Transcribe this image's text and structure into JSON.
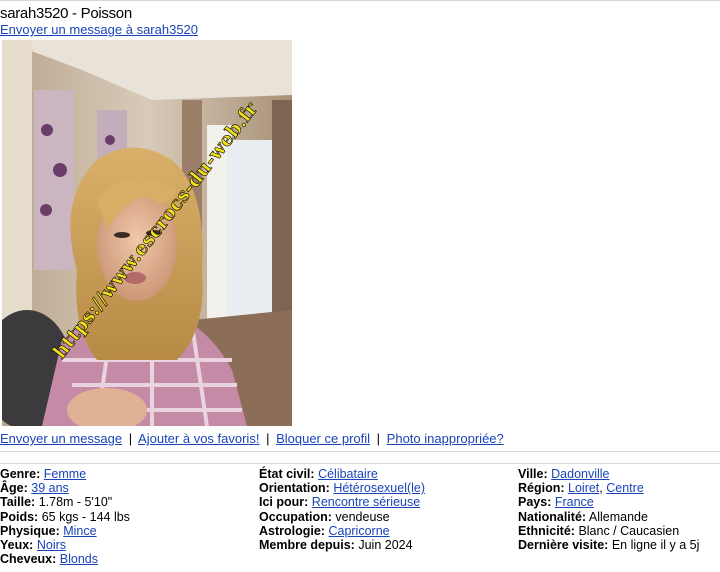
{
  "profile": {
    "title": "sarah3520 - Poisson",
    "send_message_link": "Envoyer un message à sarah3520",
    "photo": {
      "watermark": "https://www.escrocs-du-web.fr"
    }
  },
  "actions": {
    "send_message": "Envoyer un message",
    "add_favorite": "Ajouter à vos favoris!",
    "block": "Bloquer ce profil",
    "report_photo": "Photo inappropriée?",
    "separator": "|"
  },
  "details": {
    "col1": [
      {
        "label": "Genre:",
        "value": "Femme",
        "link": true
      },
      {
        "label": "Âge:",
        "value": "39 ans",
        "link": true
      },
      {
        "label": "Taille:",
        "value": "1.78m - 5'10\"",
        "link": false
      },
      {
        "label": "Poids:",
        "value": "65 kgs - 144 lbs",
        "link": false
      },
      {
        "label": "Physique:",
        "value": "Mince",
        "link": true
      },
      {
        "label": "Yeux:",
        "value": "Noirs",
        "link": true
      },
      {
        "label": "Cheveux:",
        "value": "Blonds",
        "link": true
      }
    ],
    "col2": [
      {
        "label": "État civil:",
        "value": "Célibataire",
        "link": true
      },
      {
        "label": "Orientation:",
        "value": "Hétérosexuel(le)",
        "link": true
      },
      {
        "label": "Ici pour:",
        "value": "Rencontre sérieuse",
        "link": true
      },
      {
        "label": "Occupation:",
        "value": "vendeuse",
        "link": false
      },
      {
        "label": "Astrologie:",
        "value": "Capricorne",
        "link": true
      },
      {
        "label": "Membre depuis:",
        "value": "Juin 2024",
        "link": false
      }
    ],
    "col3": [
      {
        "label": "Ville:",
        "value": "Dadonville",
        "link": true
      },
      {
        "label": "Région:",
        "value": "Loiret",
        "value2": "Centre",
        "link": true
      },
      {
        "label": "Pays:",
        "value": "France",
        "link": true
      },
      {
        "label": "Nationalité:",
        "value": "Allemande",
        "link": false
      },
      {
        "label": "Ethnicité:",
        "value": "Blanc / Caucasien",
        "link": false
      },
      {
        "label": "Dernière visite:",
        "value": "En ligne il y a 5j",
        "link": false
      }
    ]
  },
  "colors": {
    "link": "#1a44b8",
    "watermark": "#f2e21a"
  }
}
